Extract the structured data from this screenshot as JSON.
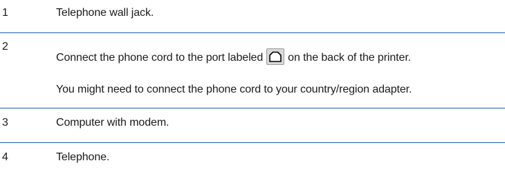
{
  "rows": [
    {
      "number": "1",
      "text": "Telephone wall jack."
    },
    {
      "number": "2",
      "text_before_icon": "Connect the phone cord to the port labeled",
      "icon": "phone-port-icon",
      "text_after_icon": "on the back of the printer.",
      "note": "You might need to connect the phone cord to your country/region adapter."
    },
    {
      "number": "3",
      "text": "Computer with modem."
    },
    {
      "number": "4",
      "text": "Telephone."
    }
  ],
  "colors": {
    "divider": "#1b5fa6",
    "text": "#1a1a1a",
    "icon_fill": "#d9d9d9",
    "icon_stroke": "#000000"
  }
}
